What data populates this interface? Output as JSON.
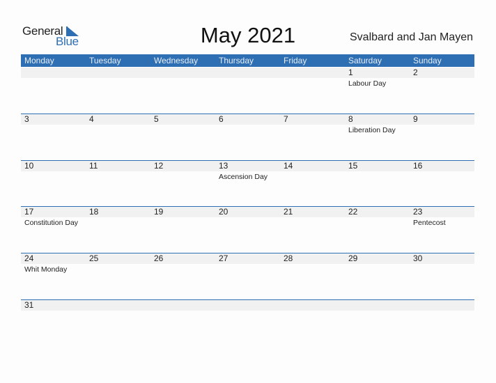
{
  "logo": {
    "part1": "General",
    "part2": "Blue"
  },
  "title": "May 2021",
  "country": "Svalbard and Jan Mayen",
  "colors": {
    "accent": "#2e6fb3",
    "band": "#f1f1f1"
  },
  "days_of_week": [
    "Monday",
    "Tuesday",
    "Wednesday",
    "Thursday",
    "Friday",
    "Saturday",
    "Sunday"
  ],
  "weeks": [
    [
      {
        "day": "",
        "holiday": ""
      },
      {
        "day": "",
        "holiday": ""
      },
      {
        "day": "",
        "holiday": ""
      },
      {
        "day": "",
        "holiday": ""
      },
      {
        "day": "",
        "holiday": ""
      },
      {
        "day": "1",
        "holiday": "Labour Day"
      },
      {
        "day": "2",
        "holiday": ""
      }
    ],
    [
      {
        "day": "3",
        "holiday": ""
      },
      {
        "day": "4",
        "holiday": ""
      },
      {
        "day": "5",
        "holiday": ""
      },
      {
        "day": "6",
        "holiday": ""
      },
      {
        "day": "7",
        "holiday": ""
      },
      {
        "day": "8",
        "holiday": "Liberation Day"
      },
      {
        "day": "9",
        "holiday": ""
      }
    ],
    [
      {
        "day": "10",
        "holiday": ""
      },
      {
        "day": "11",
        "holiday": ""
      },
      {
        "day": "12",
        "holiday": ""
      },
      {
        "day": "13",
        "holiday": "Ascension Day"
      },
      {
        "day": "14",
        "holiday": ""
      },
      {
        "day": "15",
        "holiday": ""
      },
      {
        "day": "16",
        "holiday": ""
      }
    ],
    [
      {
        "day": "17",
        "holiday": "Constitution Day"
      },
      {
        "day": "18",
        "holiday": ""
      },
      {
        "day": "19",
        "holiday": ""
      },
      {
        "day": "20",
        "holiday": ""
      },
      {
        "day": "21",
        "holiday": ""
      },
      {
        "day": "22",
        "holiday": ""
      },
      {
        "day": "23",
        "holiday": "Pentecost"
      }
    ],
    [
      {
        "day": "24",
        "holiday": "Whit Monday"
      },
      {
        "day": "25",
        "holiday": ""
      },
      {
        "day": "26",
        "holiday": ""
      },
      {
        "day": "27",
        "holiday": ""
      },
      {
        "day": "28",
        "holiday": ""
      },
      {
        "day": "29",
        "holiday": ""
      },
      {
        "day": "30",
        "holiday": ""
      }
    ],
    [
      {
        "day": "31",
        "holiday": ""
      },
      {
        "day": "",
        "holiday": ""
      },
      {
        "day": "",
        "holiday": ""
      },
      {
        "day": "",
        "holiday": ""
      },
      {
        "day": "",
        "holiday": ""
      },
      {
        "day": "",
        "holiday": ""
      },
      {
        "day": "",
        "holiday": ""
      }
    ]
  ]
}
